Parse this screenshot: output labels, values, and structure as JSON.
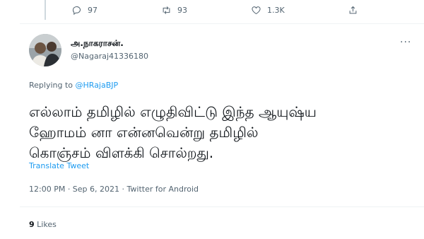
{
  "previous_tweet_actions": {
    "replies": "97",
    "retweets": "93",
    "likes": "1.3K"
  },
  "tweet": {
    "author_name": "அ.நாகராசன்.",
    "author_handle": "@Nagaraj41336180",
    "more_label": "···",
    "replying_prefix": "Replying to",
    "replying_to": "@HRajaBJP",
    "text_lines": [
      "எல்லாம் தமிழில் எழுதிவிட்டு இந்த ஆயுஷ்ய",
      "ஹோமம் னா என்னவென்று தமிழில்",
      "கொஞ்சம் விளக்கி சொல்றது."
    ],
    "translate_label": "Translate Tweet",
    "meta": "12:00 PM · Sep 6, 2021 · Twitter for Android",
    "likes_count": "9",
    "likes_label": "Likes"
  }
}
